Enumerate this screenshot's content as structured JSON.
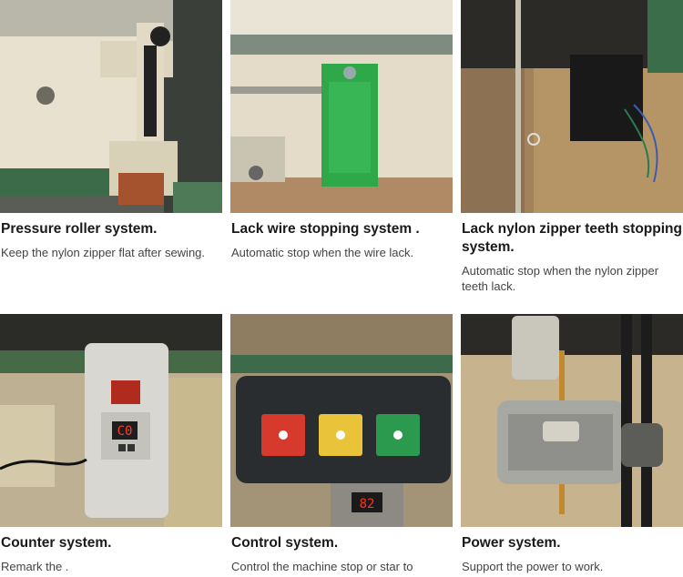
{
  "features": [
    {
      "title": "Pressure roller system.",
      "description": "Keep the nylon zipper flat after sewing."
    },
    {
      "title": "Lack wire stopping system .",
      "description": "Automatic stop when the wire lack."
    },
    {
      "title": "Lack nylon zipper teeth stopping system.",
      "description": "Automatic stop when the nylon zipper teeth lack."
    },
    {
      "title": "Counter system.",
      "description": "Remark the ."
    },
    {
      "title": "Control system.",
      "description": "Control the machine stop or star to"
    },
    {
      "title": "Power system.",
      "description": "Support the power to work."
    }
  ],
  "counter_display": "C0",
  "control_display": "82"
}
